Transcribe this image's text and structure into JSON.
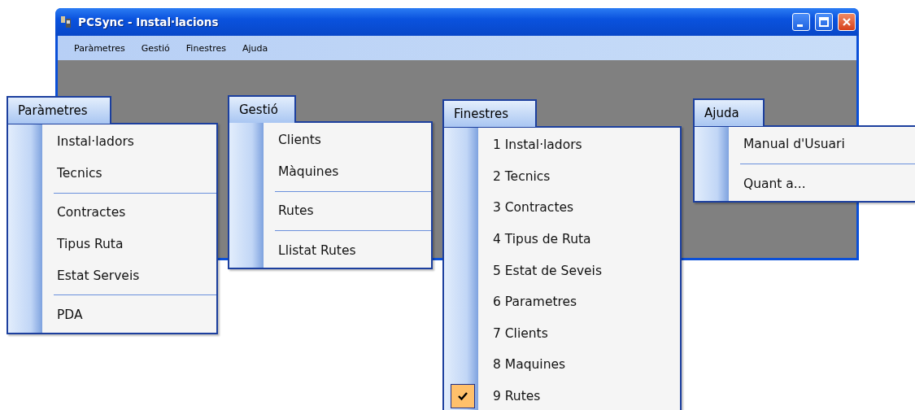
{
  "window": {
    "title": "PCSync - Instal·lacions"
  },
  "menubar": [
    "Paràmetres",
    "Gestió",
    "Finestres",
    "Ajuda"
  ],
  "menus": [
    {
      "title": "Paràmetres",
      "items": [
        {
          "kind": "item",
          "label": "Instal·ladors"
        },
        {
          "kind": "item",
          "label": "Tecnics"
        },
        {
          "kind": "separator"
        },
        {
          "kind": "item",
          "label": "Contractes"
        },
        {
          "kind": "item",
          "label": "Tipus Ruta"
        },
        {
          "kind": "item",
          "label": "Estat Serveis"
        },
        {
          "kind": "separator"
        },
        {
          "kind": "item",
          "label": "PDA"
        }
      ]
    },
    {
      "title": "Gestió",
      "items": [
        {
          "kind": "item",
          "label": "Clients"
        },
        {
          "kind": "item",
          "label": "Màquines"
        },
        {
          "kind": "separator"
        },
        {
          "kind": "item",
          "label": "Rutes"
        },
        {
          "kind": "separator"
        },
        {
          "kind": "item",
          "label": "Llistat Rutes"
        }
      ]
    },
    {
      "title": "Finestres",
      "items": [
        {
          "kind": "item",
          "label": "1 Instal·ladors",
          "checked": false
        },
        {
          "kind": "item",
          "label": "2 Tecnics",
          "checked": false
        },
        {
          "kind": "item",
          "label": "3 Contractes",
          "checked": false
        },
        {
          "kind": "item",
          "label": "4 Tipus de Ruta",
          "checked": false
        },
        {
          "kind": "item",
          "label": "5 Estat de Seveis",
          "checked": false
        },
        {
          "kind": "item",
          "label": "6 Parametres",
          "checked": false
        },
        {
          "kind": "item",
          "label": "7 Clients",
          "checked": false
        },
        {
          "kind": "item",
          "label": "8 Maquines",
          "checked": false
        },
        {
          "kind": "item",
          "label": "9 Rutes",
          "checked": true
        }
      ]
    },
    {
      "title": "Ajuda",
      "items": [
        {
          "kind": "item",
          "label": "Manual d'Usuari"
        },
        {
          "kind": "separator"
        },
        {
          "kind": "item",
          "label": "Quant a..."
        }
      ]
    }
  ]
}
